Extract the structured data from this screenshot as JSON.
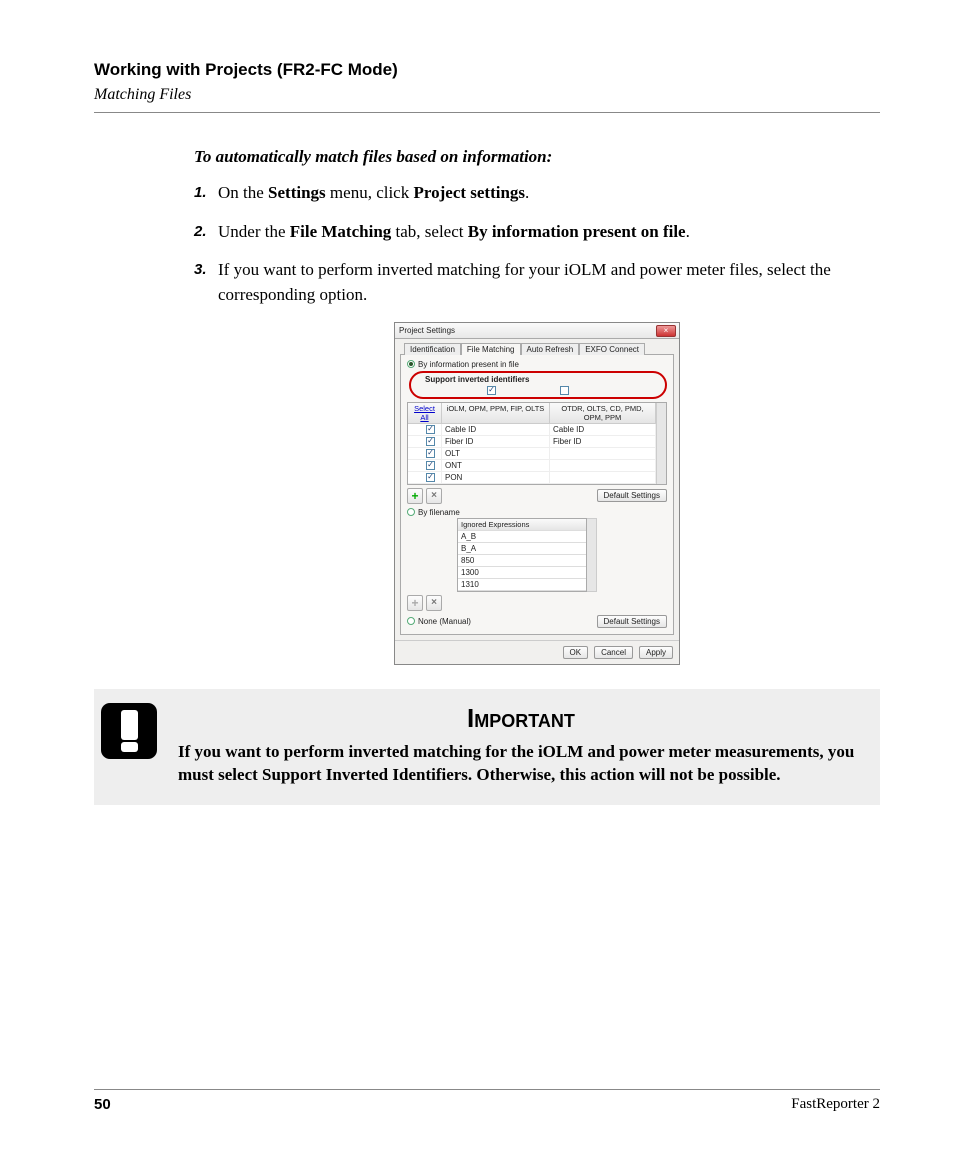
{
  "header": {
    "title": "Working with Projects (FR2-FC Mode)",
    "subtitle": "Matching Files"
  },
  "intro": "To automatically match files based on information:",
  "steps": [
    {
      "num": "1.",
      "pre": "On the ",
      "b1": "Settings",
      "mid": " menu, click ",
      "b2": "Project settings",
      "post": "."
    },
    {
      "num": "2.",
      "pre": "Under the ",
      "b1": "File Matching",
      "mid": " tab, select ",
      "b2": "By information present on file",
      "post": "."
    },
    {
      "num": "3.",
      "plain": "If you want to perform inverted matching for your iOLM and power meter files, select the corresponding option."
    }
  ],
  "dialog": {
    "title": "Project Settings",
    "close": "×",
    "tabs": [
      "Identification",
      "File Matching",
      "Auto Refresh",
      "EXFO Connect"
    ],
    "radio_info": "By information present in file",
    "inverted_label": "Support inverted identifiers",
    "grid": {
      "select_label": "Select",
      "select_all": "All",
      "col2": "iOLM, OPM, PPM, FIP, OLTS",
      "col3": "OTDR, OLTS, CD, PMD, OPM, PPM",
      "rows": [
        {
          "c2": "Cable ID",
          "c3": "Cable ID"
        },
        {
          "c2": "Fiber ID",
          "c3": "Fiber ID"
        },
        {
          "c2": "OLT",
          "c3": ""
        },
        {
          "c2": "ONT",
          "c3": ""
        },
        {
          "c2": "PON",
          "c3": ""
        }
      ],
      "default_btn": "Default Settings"
    },
    "radio_filename": "By filename",
    "ignored": {
      "header": "Ignored Expressions",
      "rows": [
        "A_B",
        "B_A",
        "850",
        "1300",
        "1310"
      ]
    },
    "radio_none": "None (Manual)",
    "default_btn2": "Default Settings",
    "footer": {
      "ok": "OK",
      "cancel": "Cancel",
      "apply": "Apply"
    }
  },
  "important": {
    "title": "Important",
    "text": "If you want to perform inverted matching for the iOLM and power meter measurements, you must select Support Inverted Identifiers. Otherwise, this action will not be possible."
  },
  "footer": {
    "page": "50",
    "product": "FastReporter 2"
  }
}
